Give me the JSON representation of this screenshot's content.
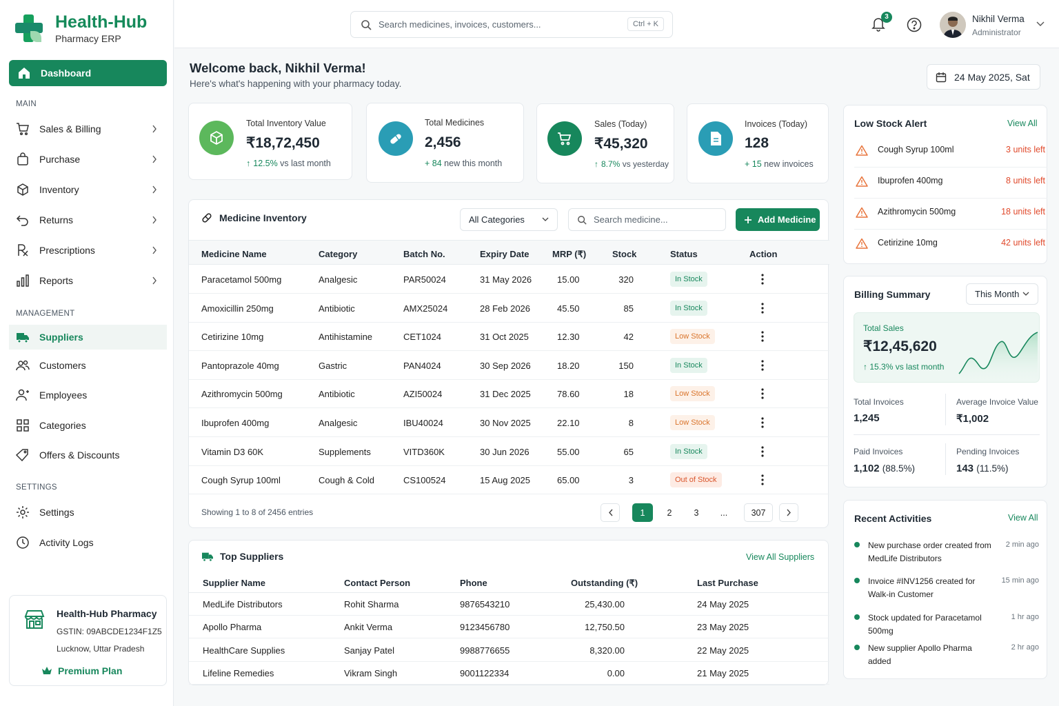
{
  "brand": {
    "name": "Health-Hub",
    "subtitle": "Pharmacy ERP"
  },
  "nav": {
    "dashboard": "Dashboard",
    "section_main": "MAIN",
    "main_items": [
      {
        "label": "Sales & Billing",
        "icon": "cart-icon"
      },
      {
        "label": "Purchase",
        "icon": "bag-icon"
      },
      {
        "label": "Inventory",
        "icon": "box-icon"
      },
      {
        "label": "Returns",
        "icon": "return-icon"
      },
      {
        "label": "Prescriptions",
        "icon": "rx-icon"
      },
      {
        "label": "Reports",
        "icon": "bar-chart-icon"
      }
    ],
    "section_management": "MANAGEMENT",
    "management_items": [
      {
        "label": "Suppliers",
        "icon": "truck-icon"
      },
      {
        "label": "Customers",
        "icon": "users-icon"
      },
      {
        "label": "Employees",
        "icon": "user-icon"
      },
      {
        "label": "Categories",
        "icon": "grid-icon"
      },
      {
        "label": "Offers & Discounts",
        "icon": "tag-icon"
      }
    ],
    "section_settings": "SETTINGS",
    "settings_items": [
      {
        "label": "Settings",
        "icon": "gear-icon"
      },
      {
        "label": "Activity Logs",
        "icon": "clock-icon"
      }
    ]
  },
  "pharmacy": {
    "name": "Health-Hub Pharmacy",
    "gstin": "GSTIN: 09ABCDE1234F1Z5",
    "location": "Lucknow, Uttar Pradesh",
    "plan": "Premium Plan"
  },
  "topbar": {
    "search_placeholder": "Search medicines, invoices, customers...",
    "shortcut": "Ctrl + K",
    "notification_count": "3",
    "user_name": "Nikhil Verma",
    "user_role": "Administrator"
  },
  "welcome": {
    "title": "Welcome back, Nikhil Verma!",
    "subtitle": "Here's what's happening with your pharmacy today.",
    "date": "24 May 2025, Sat"
  },
  "stats": [
    {
      "label": "Total Inventory Value",
      "value": "₹18,72,450",
      "delta": "12.5%",
      "delta_text": " vs last month",
      "color": "#5cb85c"
    },
    {
      "label": "Total Medicines",
      "value": "2,456",
      "delta": "+ 84",
      "delta_text": " new this month",
      "color": "#2a9db5"
    },
    {
      "label": "Sales (Today)",
      "value": "₹45,320",
      "delta": "8.7%",
      "delta_text": " vs yesterday",
      "color": "#17875c"
    },
    {
      "label": "Invoices (Today)",
      "value": "128",
      "delta": "+ 15",
      "delta_text": " new invoices",
      "color": "#2a9db5"
    }
  ],
  "inventory": {
    "title": "Medicine Inventory",
    "category_select": "All Categories",
    "search_placeholder": "Search medicine...",
    "add_button": "Add Medicine",
    "columns": [
      "Medicine Name",
      "Category",
      "Batch No.",
      "Expiry Date",
      "MRP (₹)",
      "Stock",
      "Status",
      "Action"
    ],
    "rows": [
      {
        "name": "Paracetamol 500mg",
        "category": "Analgesic",
        "batch": "PAR50024",
        "expiry": "31 May 2026",
        "mrp": "15.00",
        "stock": "320",
        "status": "In Stock"
      },
      {
        "name": "Amoxicillin 250mg",
        "category": "Antibiotic",
        "batch": "AMX25024",
        "expiry": "28 Feb 2026",
        "mrp": "45.50",
        "stock": "85",
        "status": "In Stock"
      },
      {
        "name": "Cetirizine 10mg",
        "category": "Antihistamine",
        "batch": "CET1024",
        "expiry": "31 Oct 2025",
        "mrp": "12.30",
        "stock": "42",
        "status": "Low Stock"
      },
      {
        "name": "Pantoprazole 40mg",
        "category": "Gastric",
        "batch": "PAN4024",
        "expiry": "30 Sep 2026",
        "mrp": "18.20",
        "stock": "150",
        "status": "In Stock"
      },
      {
        "name": "Azithromycin 500mg",
        "category": "Antibiotic",
        "batch": "AZI50024",
        "expiry": "31 Dec 2025",
        "mrp": "78.60",
        "stock": "18",
        "status": "Low Stock"
      },
      {
        "name": "Ibuprofen 400mg",
        "category": "Analgesic",
        "batch": "IBU40024",
        "expiry": "30 Nov 2025",
        "mrp": "22.10",
        "stock": "8",
        "status": "Low Stock"
      },
      {
        "name": "Vitamin D3 60K",
        "category": "Supplements",
        "batch": "VITD360K",
        "expiry": "30 Jun 2026",
        "mrp": "55.00",
        "stock": "65",
        "status": "In Stock"
      },
      {
        "name": "Cough Syrup 100ml",
        "category": "Cough & Cold",
        "batch": "CS100524",
        "expiry": "15 Aug 2025",
        "mrp": "65.00",
        "stock": "3",
        "status": "Out of Stock"
      }
    ],
    "showing": "Showing 1 to 8 of 2456 entries",
    "pages": [
      "1",
      "2",
      "3",
      "...",
      "307"
    ]
  },
  "suppliers": {
    "title": "Top Suppliers",
    "view_all": "View All Suppliers",
    "columns": [
      "Supplier Name",
      "Contact Person",
      "Phone",
      "Outstanding (₹)",
      "Last Purchase"
    ],
    "rows": [
      {
        "name": "MedLife Distributors",
        "contact": "Rohit Sharma",
        "phone": "9876543210",
        "outstanding": "25,430.00",
        "last": "24 May 2025"
      },
      {
        "name": "Apollo Pharma",
        "contact": "Ankit Verma",
        "phone": "9123456780",
        "outstanding": "12,750.50",
        "last": "23 May 2025"
      },
      {
        "name": "HealthCare Supplies",
        "contact": "Sanjay Patel",
        "phone": "9988776655",
        "outstanding": "8,320.00",
        "last": "22 May 2025"
      },
      {
        "name": "Lifeline Remedies",
        "contact": "Vikram Singh",
        "phone": "9001122334",
        "outstanding": "0.00",
        "last": "21 May 2025"
      }
    ]
  },
  "low_stock": {
    "title": "Low Stock Alert",
    "view_all": "View All",
    "items": [
      {
        "name": "Cough Syrup 100ml",
        "left": "3 units left"
      },
      {
        "name": "Ibuprofen 400mg",
        "left": "8 units left"
      },
      {
        "name": "Azithromycin 500mg",
        "left": "18 units left"
      },
      {
        "name": "Cetirizine 10mg",
        "left": "42 units left"
      }
    ]
  },
  "billing": {
    "title": "Billing Summary",
    "period": "This Month",
    "total_sales_label": "Total Sales",
    "total_sales": "₹12,45,620",
    "growth": "15.3% vs last month",
    "total_invoices_label": "Total Invoices",
    "total_invoices": "1,245",
    "avg_label": "Average Invoice Value",
    "avg_value": "₹1,002",
    "paid_label": "Paid Invoices",
    "paid_value": "1,102",
    "paid_pct": "(88.5%)",
    "pending_label": "Pending Invoices",
    "pending_value": "143",
    "pending_pct": "(11.5%)"
  },
  "activities": {
    "title": "Recent Activities",
    "view_all": "View All",
    "items": [
      {
        "text": "New purchase order created from MedLife Distributors",
        "time": "2 min ago"
      },
      {
        "text": "Invoice #INV1256 created for Walk-in Customer",
        "time": "15 min ago"
      },
      {
        "text": "Stock updated for Paracetamol 500mg",
        "time": "1 hr ago"
      },
      {
        "text": "New supplier Apollo Pharma added",
        "time": "2 hr ago"
      }
    ]
  },
  "colors": {
    "accent": "#17875c",
    "low": "#d9742b",
    "danger": "#e0492b"
  }
}
